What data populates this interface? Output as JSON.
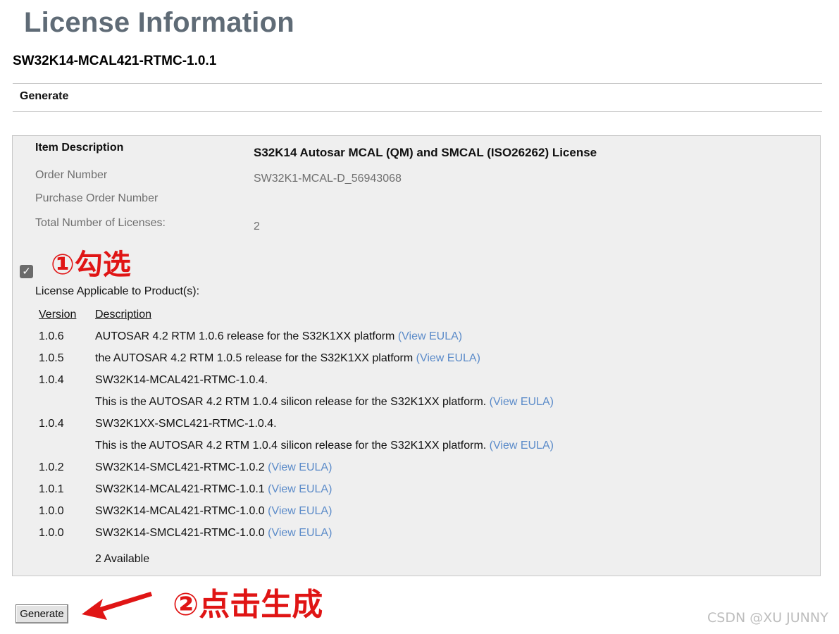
{
  "page": {
    "title": "License Information",
    "product_id": "SW32K14-MCAL421-RTMC-1.0.1",
    "section_heading": "Generate"
  },
  "details": {
    "item_description_label": "Item Description",
    "item_description_value": "S32K14 Autosar MCAL (QM) and SMCAL (ISO26262) License",
    "order_number_label": "Order Number",
    "order_number_value": "SW32K1-MCAL-D_56943068",
    "purchase_order_label": "Purchase Order Number",
    "purchase_order_value": "",
    "total_licenses_label": "Total Number of Licenses:",
    "total_licenses_value": "2"
  },
  "checkbox": {
    "checked": true,
    "glyph": "✓"
  },
  "applicable": {
    "label": "License Applicable to Product(s):",
    "col_version": "Version",
    "col_description": "Description",
    "rows": [
      {
        "version": "1.0.6",
        "description": "AUTOSAR 4.2 RTM 1.0.6 release for the S32K1XX platform",
        "link": "(View EULA)"
      },
      {
        "version": "1.0.5",
        "description": "the AUTOSAR 4.2 RTM 1.0.5 release for the S32K1XX platform",
        "link": "(View EULA)"
      },
      {
        "version": "1.0.4",
        "description": "SW32K14-MCAL421-RTMC-1.0.4.",
        "link": ""
      },
      {
        "version": "",
        "description": "This is the AUTOSAR 4.2 RTM 1.0.4 silicon release for the S32K1XX platform.",
        "link": "(View EULA)"
      },
      {
        "version": "1.0.4",
        "description": "SW32K1XX-SMCL421-RTMC-1.0.4.",
        "link": ""
      },
      {
        "version": "",
        "description": "This is the AUTOSAR 4.2 RTM 1.0.4 silicon release for the S32K1XX platform.",
        "link": "(View EULA)"
      },
      {
        "version": "1.0.2",
        "description": "SW32K14-SMCL421-RTMC-1.0.2",
        "link": "(View EULA)"
      },
      {
        "version": "1.0.1",
        "description": "SW32K14-MCAL421-RTMC-1.0.1",
        "link": "(View EULA)"
      },
      {
        "version": "1.0.0",
        "description": "SW32K14-MCAL421-RTMC-1.0.0",
        "link": "(View EULA)"
      },
      {
        "version": "1.0.0",
        "description": "SW32K14-SMCL421-RTMC-1.0.0",
        "link": "(View EULA)"
      }
    ],
    "available": "2 Available"
  },
  "generate_button": {
    "label": "Generate"
  },
  "annotations": {
    "step1": "①勾选",
    "step2": "②点击生成",
    "color": "#e01515"
  },
  "watermark": "CSDN @XU JUNNY",
  "colors": {
    "title": "#5f6b76",
    "panel_bg": "#efefef",
    "link": "#5b8bc9",
    "muted_text": "#6f6f6f"
  }
}
